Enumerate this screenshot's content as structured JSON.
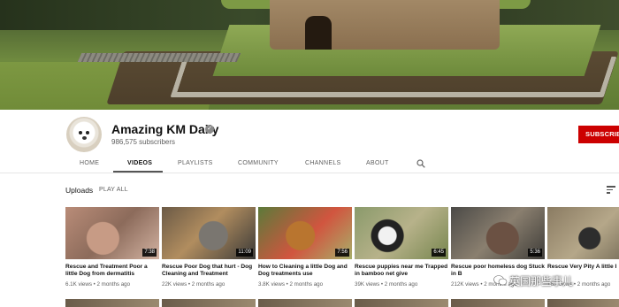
{
  "channel": {
    "name": "Amazing KM Daily",
    "subscribers": "986,575 subscribers",
    "subscribe_label": "SUBSCRIBE"
  },
  "tabs": [
    {
      "label": "HOME"
    },
    {
      "label": "VIDEOS",
      "active": true
    },
    {
      "label": "PLAYLISTS"
    },
    {
      "label": "COMMUNITY"
    },
    {
      "label": "CHANNELS"
    },
    {
      "label": "ABOUT"
    }
  ],
  "uploads": {
    "title": "Uploads",
    "play_all": "PLAY ALL"
  },
  "videos": [
    {
      "title": "Rescue and Treatment Poor a little Dog from dermatitis",
      "meta": "6.1K views • 2 months ago",
      "duration": "7:38"
    },
    {
      "title": "Rescue Poor Dog that hurt - Dog Cleaning and Treatment",
      "meta": "22K views • 2 months ago",
      "duration": "11:09"
    },
    {
      "title": "How to Cleaning a little Dog and Dog treatments use",
      "meta": "3.8K views • 2 months ago",
      "duration": "7:56"
    },
    {
      "title": "Rescue puppies near me Trapped in bamboo net give",
      "meta": "39K views • 2 months ago",
      "duration": "6:45"
    },
    {
      "title": "Rescue poor homeless dog Stuck in B",
      "meta": "212K views • 2 months ago",
      "duration": "5:36"
    },
    {
      "title": "Rescue Very Pity A little I",
      "meta": "18K views • 2 months ago",
      "duration": ""
    }
  ],
  "watermark": {
    "text": "英国那些事儿"
  },
  "icons": {
    "verified": "verified-check-icon",
    "search": "search-icon",
    "sort": "sort-icon",
    "watermark": "wechat-icon"
  },
  "colors": {
    "subscribe": "#cc0000",
    "active_tab_underline": "#555555"
  }
}
